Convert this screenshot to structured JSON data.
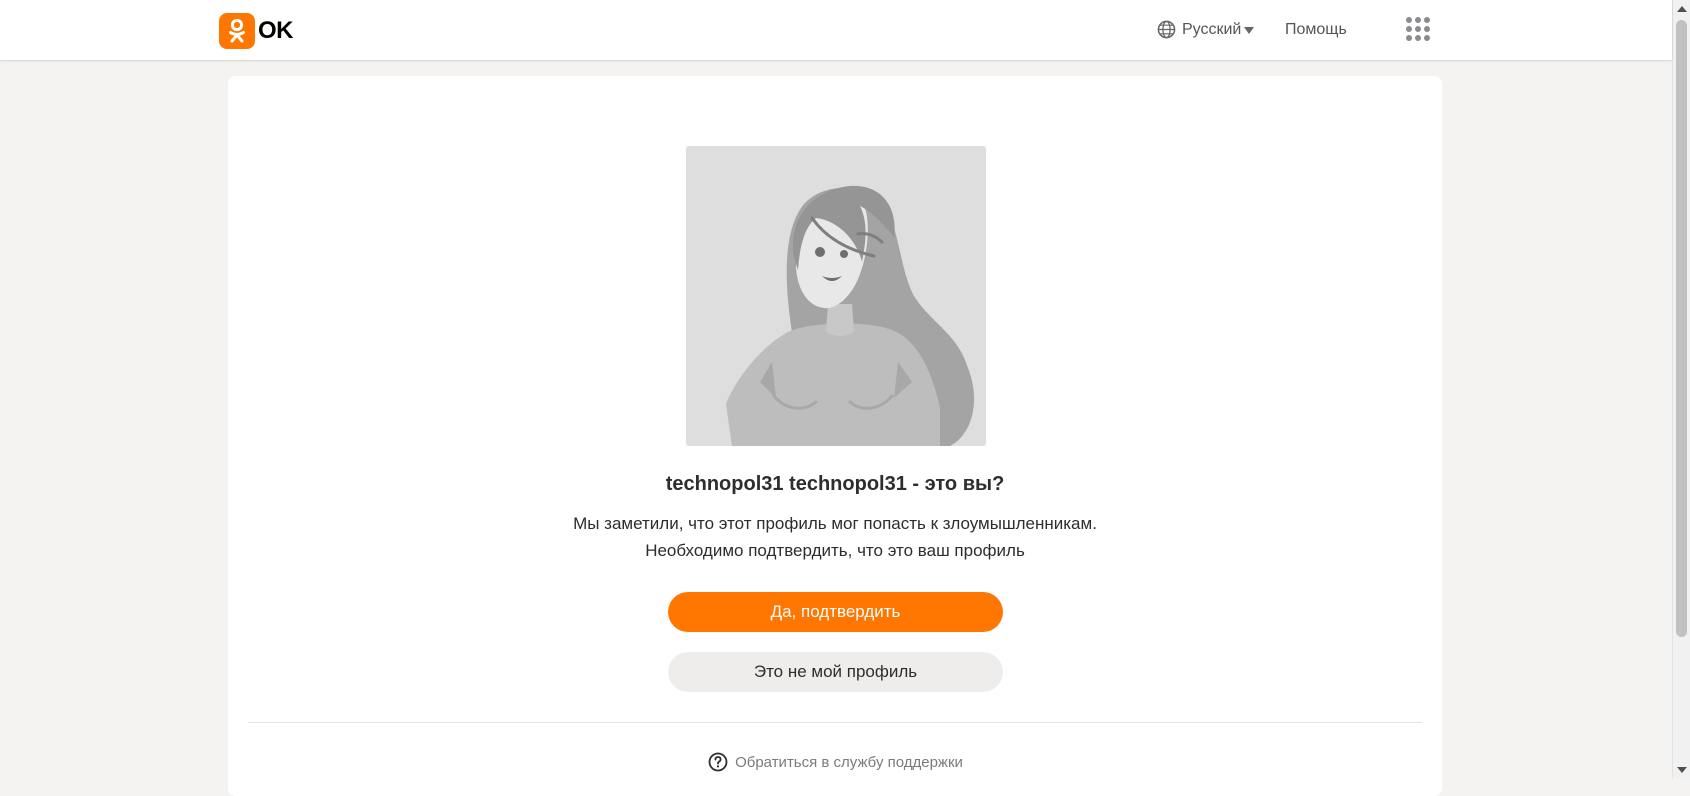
{
  "header": {
    "logo_text": "OK",
    "language_label": "Русский",
    "help_label": "Помощь"
  },
  "profile": {
    "title": "technopol31 technopol31 - это вы?",
    "description_line1": "Мы заметили, что этот профиль мог попасть к злоумышленникам.",
    "description_line2": "Необходимо подтвердить, что это ваш профиль"
  },
  "actions": {
    "confirm_label": "Да, подтвердить",
    "not_mine_label": "Это не мой профиль"
  },
  "footer": {
    "support_label": "Обратиться в службу поддержки"
  },
  "colors": {
    "brand_orange": "#ff7700",
    "secondary_button": "#efedeb",
    "page_background": "#f5f3f1"
  },
  "icons": [
    "ok-logo-icon",
    "globe-icon",
    "caret-down-icon",
    "apps-grid-icon",
    "question-circle-icon",
    "default-avatar-female"
  ]
}
